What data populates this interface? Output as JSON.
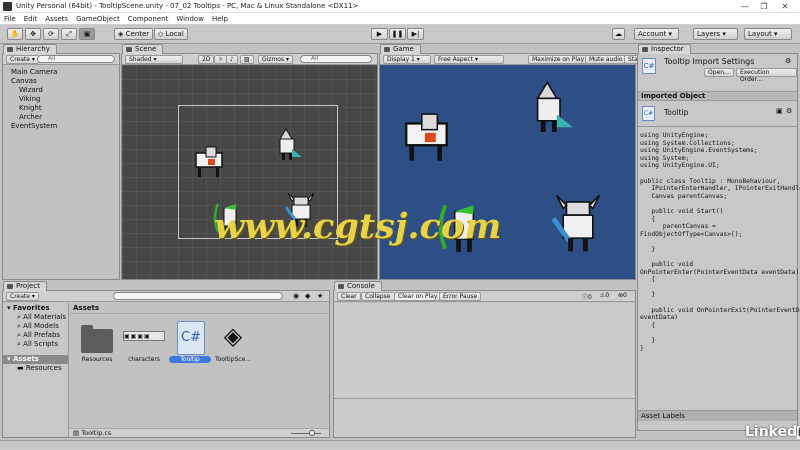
{
  "window": {
    "title": "Unity Personal (64bit) - TooltipScene.unity - 07_02 Tooltips - PC, Mac & Linux Standalone <DX11>"
  },
  "menu": [
    "File",
    "Edit",
    "Assets",
    "GameObject",
    "Component",
    "Window",
    "Help"
  ],
  "toolbar": {
    "center_label": "Center",
    "local_label": "Local",
    "account_label": "Account",
    "layers_label": "Layers",
    "layout_label": "Layout"
  },
  "hierarchy": {
    "tab": "Hierarchy",
    "create": "Create",
    "search_placeholder": "All",
    "items": [
      "Main Camera",
      "Canvas",
      "Wizard",
      "Viking",
      "Knight",
      "Archer",
      "EventSystem"
    ]
  },
  "scene": {
    "tab": "Scene",
    "shading": "Shaded",
    "mode_2d": "2D",
    "gizmos": "Gizmos",
    "search_placeholder": "All"
  },
  "game": {
    "tab": "Game",
    "display": "Display 1",
    "aspect": "Free Aspect",
    "maximize": "Maximize on Play",
    "mute": "Mute audio",
    "stats": "Sta"
  },
  "watermark": "www.cgtsj.com",
  "inspector": {
    "tab": "Inspector",
    "import_title": "Tooltip Import Settings",
    "open_label": "Open...",
    "exec_label": "Execution Order...",
    "imported_header": "Imported Object",
    "object_name": "Tooltip",
    "code": [
      "using UnityEngine;",
      "using System.Collections;",
      "using UnityEngine.EventSystems;",
      "using System;",
      "using UnityEngine.UI;",
      "",
      "public class Tooltip : MonoBehaviour,",
      "   IPointerEnterHandler, IPointerExitHandler {",
      "   Canvas parentCanvas;",
      "",
      "   public void Start()",
      "   {",
      "      parentCanvas =",
      "FindObjectOfType<Canvas>();",
      "",
      "   }",
      "",
      "   public void",
      "OnPointerEnter(PointerEventData eventData)",
      "   {",
      "",
      "   }",
      "",
      "   public void OnPointerExit(PointerEventData",
      "eventData)",
      "   {",
      "",
      "   }",
      "}"
    ],
    "asset_labels": "Asset Labels"
  },
  "project": {
    "tab": "Project",
    "create": "Create",
    "favorites_label": "Favorites",
    "favorites": [
      "All Materials",
      "All Models",
      "All Prefabs",
      "All Scripts"
    ],
    "assets_label": "Assets",
    "assets_tree": [
      "Resources"
    ],
    "breadcrumb": "Assets",
    "items": [
      {
        "name": "Resources"
      },
      {
        "name": "characters"
      },
      {
        "name": "Tooltip"
      },
      {
        "name": "TooltipSce..."
      }
    ],
    "footer_file": "Tooltip.cs"
  },
  "console": {
    "tab": "Console",
    "clear": "Clear",
    "collapse": "Collapse",
    "clear_on_play": "Clear on Play",
    "error_pause": "Error Pause",
    "counts": [
      "0",
      "0",
      "0"
    ]
  },
  "branding": "Linked in",
  "colors": {
    "game_bg": "#2e4e86",
    "scene_bg": "#474747",
    "selection_blue": "#3d7ae0",
    "watermark": "#e8d24a"
  }
}
